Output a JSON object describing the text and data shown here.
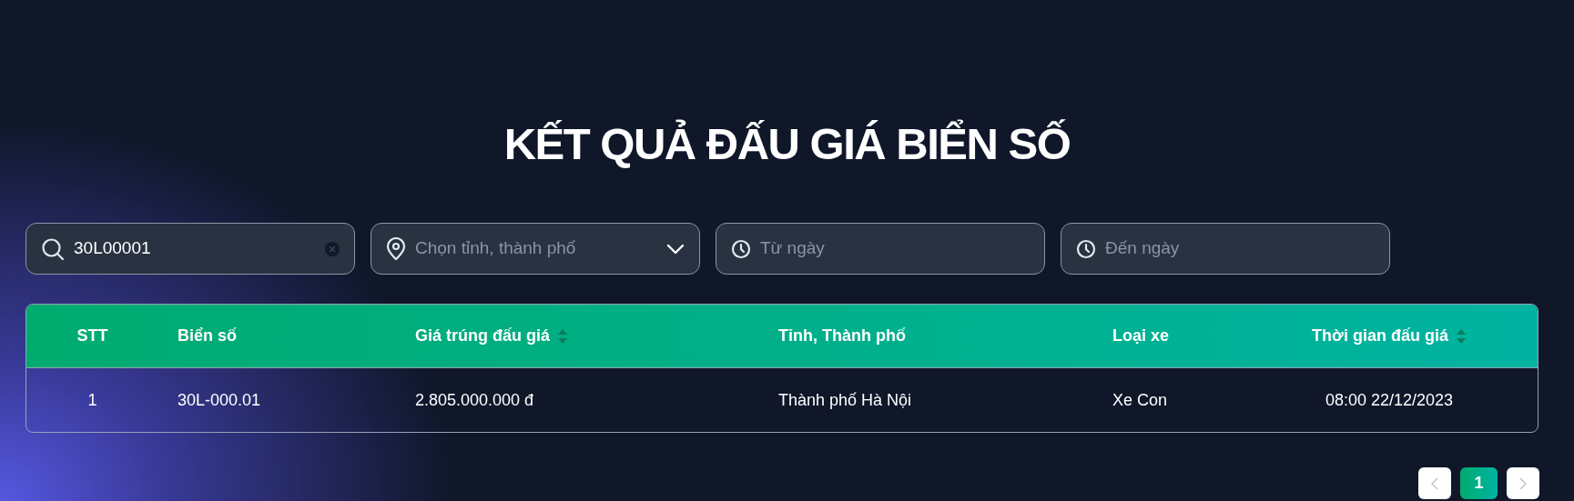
{
  "title": "KẾT QUẢ ĐẤU GIÁ BIỂN SỐ",
  "filters": [
    {
      "kind": "search",
      "value": "30L00001"
    },
    {
      "kind": "select",
      "placeholder": "Chọn tỉnh, thành phố"
    },
    {
      "kind": "date",
      "placeholder": "Từ ngày"
    },
    {
      "kind": "date",
      "placeholder": "Đến ngày"
    }
  ],
  "table": {
    "columns": [
      {
        "label": "STT",
        "sortable": false
      },
      {
        "label": "Biển số",
        "sortable": false
      },
      {
        "label": "Giá trúng đấu giá",
        "sortable": true
      },
      {
        "label": "Tỉnh, Thành phố",
        "sortable": false
      },
      {
        "label": "Loại xe",
        "sortable": false
      },
      {
        "label": "Thời gian đấu giá",
        "sortable": true
      }
    ],
    "rows": [
      [
        "1",
        "30L-000.01",
        "2.805.000.000 đ",
        "Thành phố Hà Nội",
        "Xe Con",
        "08:00 22/12/2023"
      ]
    ]
  },
  "pagination": {
    "pages": [
      {
        "label": "1",
        "selected": true
      }
    ]
  }
}
